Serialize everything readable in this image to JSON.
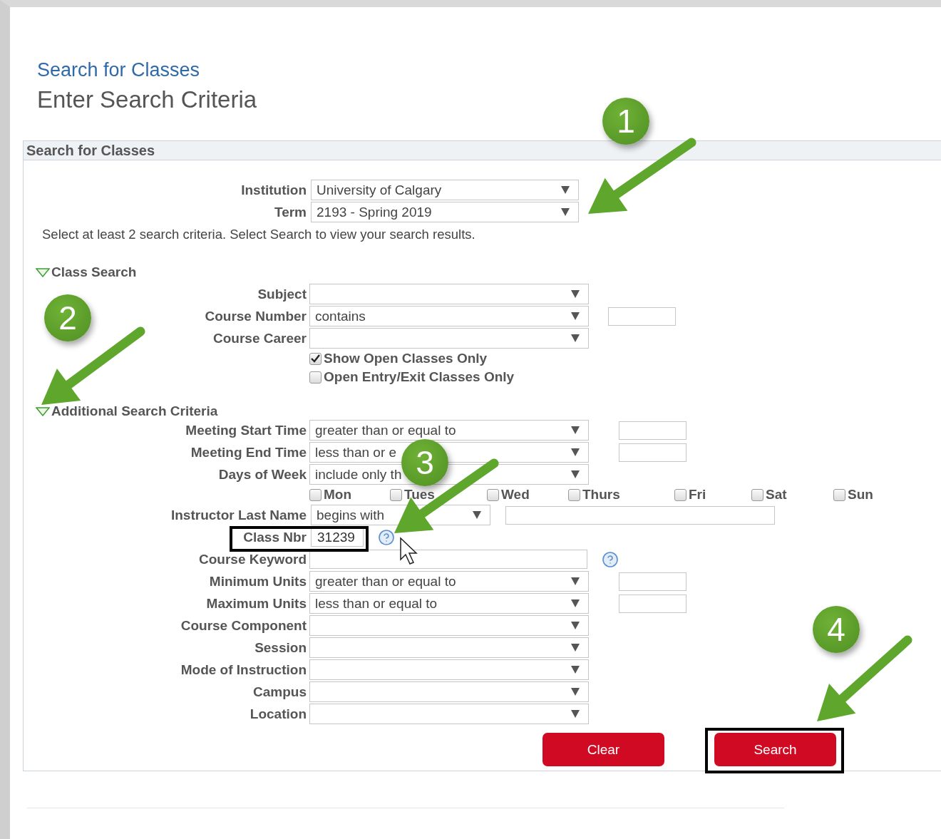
{
  "page": {
    "breadcrumb": "Search for Classes",
    "title": "Enter Search Criteria"
  },
  "panel": {
    "title": "Search for Classes"
  },
  "top_fields": [
    {
      "label": "Institution",
      "value": "University of Calgary"
    },
    {
      "label": "Term",
      "value": "2193 - Spring 2019"
    }
  ],
  "instructions": "Select at least 2 search criteria. Select Search to view your search results.",
  "sections": [
    {
      "title": "Class Search",
      "expanded": true,
      "rows": [
        {
          "kind": "select",
          "label": "Subject"
        },
        {
          "kind": "select_field",
          "label": "Course Number",
          "value": "contains"
        },
        {
          "kind": "select",
          "label": "Course Career"
        },
        {
          "kind": "checkbox",
          "text": "Show Open Classes Only",
          "checked": true
        },
        {
          "kind": "checkbox",
          "text": "Open Entry/Exit Classes Only",
          "checked": false
        }
      ]
    },
    {
      "title": "Additional Search Criteria",
      "expanded": true,
      "rows": [
        {
          "kind": "select_field",
          "label": "Meeting Start Time",
          "value": "greater than or equal to"
        },
        {
          "kind": "select_field",
          "label": "Meeting End Time",
          "value": "less than or e"
        },
        {
          "kind": "select",
          "label": "Days of Week",
          "value": "include only th"
        },
        {
          "kind": "days",
          "items": [
            {
              "label": "Mon",
              "checked": false
            },
            {
              "label": "Tues",
              "checked": false
            },
            {
              "label": "Wed",
              "checked": false
            },
            {
              "label": "Thurs",
              "checked": false
            },
            {
              "label": "Fri",
              "checked": false
            },
            {
              "label": "Sat",
              "checked": false
            },
            {
              "label": "Sun",
              "checked": false
            }
          ]
        },
        {
          "kind": "select_wide_field",
          "label": "Instructor Last Name",
          "value": "begins with"
        },
        {
          "kind": "number_field",
          "label": "Class Nbr",
          "value": "31239",
          "help": true
        },
        {
          "kind": "keyword_field",
          "label": "Course Keyword",
          "help": true
        },
        {
          "kind": "select_field",
          "label": "Minimum Units",
          "value": "greater than or equal to"
        },
        {
          "kind": "select_field",
          "label": "Maximum Units",
          "value": "less than or equal to"
        },
        {
          "kind": "select",
          "label": "Course Component"
        },
        {
          "kind": "select",
          "label": "Session"
        },
        {
          "kind": "select",
          "label": "Mode of Instruction"
        },
        {
          "kind": "select",
          "label": "Campus"
        },
        {
          "kind": "select",
          "label": "Location"
        }
      ]
    }
  ],
  "buttons": [
    {
      "label": "Clear"
    },
    {
      "label": "Search"
    }
  ],
  "annotations": [
    {
      "number": "1"
    },
    {
      "number": "2"
    },
    {
      "number": "3"
    },
    {
      "number": "4"
    }
  ]
}
